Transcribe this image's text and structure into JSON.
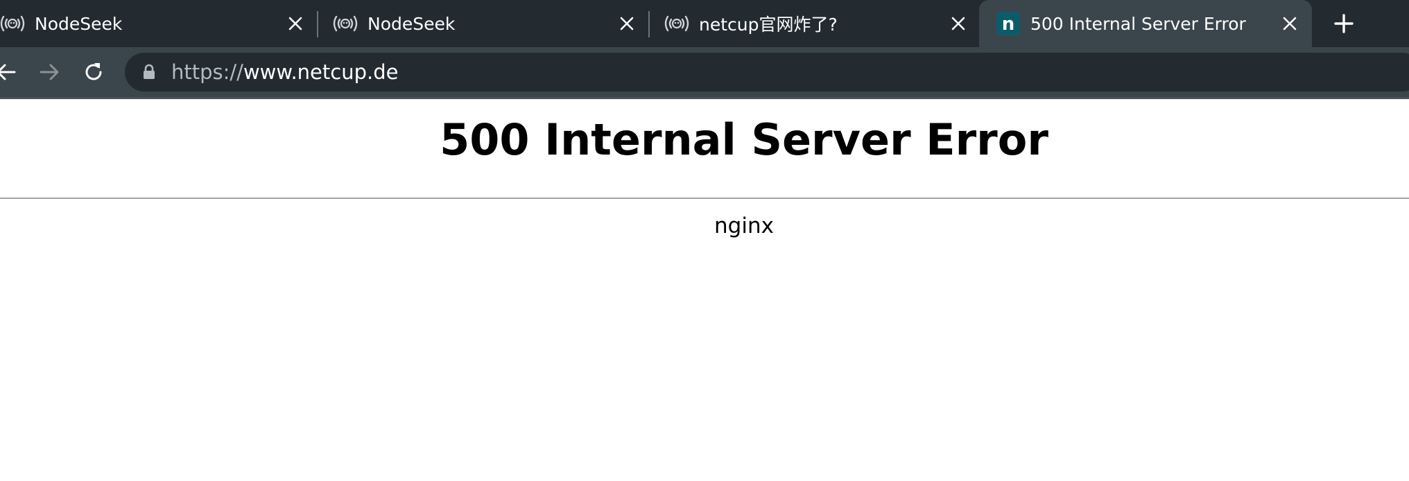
{
  "tabs": [
    {
      "title": "NodeSeek",
      "icon": "broadcast-icon",
      "active": false
    },
    {
      "title": "NodeSeek",
      "icon": "broadcast-icon",
      "active": false
    },
    {
      "title": "netcup官网炸了?",
      "icon": "broadcast-icon",
      "active": false
    },
    {
      "title": "500 Internal Server Error",
      "icon": "netcup-favicon-icon",
      "active": true,
      "favicon_letter": "n"
    }
  ],
  "colors": {
    "tabbar_bg": "#232a30",
    "active_tab_bg": "#3b454c",
    "omnibox_bg": "#232a30",
    "favicon_bg": "#0b5c6b",
    "favicon_fg": "#ffffff",
    "text_light": "#ffffff",
    "text_muted": "#b4bbbf"
  },
  "icons": {
    "back": "arrow-left-icon",
    "forward": "arrow-right-icon",
    "reload": "reload-icon",
    "lock": "lock-icon",
    "close": "close-icon",
    "new_tab": "plus-icon"
  },
  "address_bar": {
    "scheme": "https://",
    "host": "www.netcup.de"
  },
  "page": {
    "heading": "500 Internal Server Error",
    "server": "nginx"
  }
}
